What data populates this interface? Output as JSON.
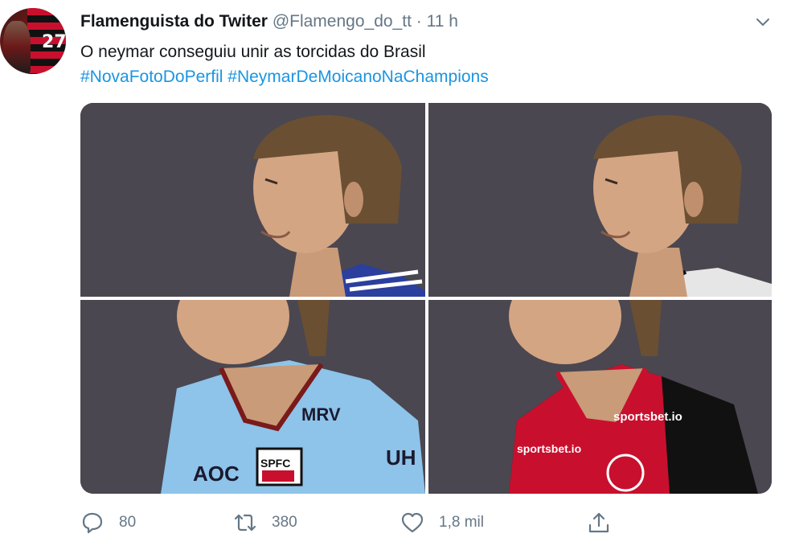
{
  "tweet": {
    "display_name": "Flamenguista do Twiter",
    "handle": "@Flamengo_do_tt",
    "separator": "·",
    "time": "11 h",
    "text": "O neymar conseguiu unir as torcidas do Brasil",
    "hashtags": [
      "#NovaFotoDoPerfil",
      "#NeymarDeMoicanoNaChampions"
    ],
    "avatar_number": "27"
  },
  "media": {
    "photos": [
      {
        "jersey": "blue-striped",
        "logos": []
      },
      {
        "jersey": "white-black",
        "logos": []
      },
      {
        "jersey": "light-blue",
        "logos": [
          "MRV",
          "AOC",
          "SPFC",
          "UH"
        ]
      },
      {
        "jersey": "red-black",
        "logos": [
          "sportsbet.io",
          "sportsbet.io"
        ]
      }
    ]
  },
  "actions": {
    "reply_count": "80",
    "retweet_count": "380",
    "like_count": "1,8 mil",
    "icons": [
      "reply-icon",
      "retweet-icon",
      "heart-icon",
      "share-icon"
    ]
  },
  "colors": {
    "link": "#1b95e0",
    "secondary_text": "#657786",
    "primary_text": "#14171a"
  }
}
